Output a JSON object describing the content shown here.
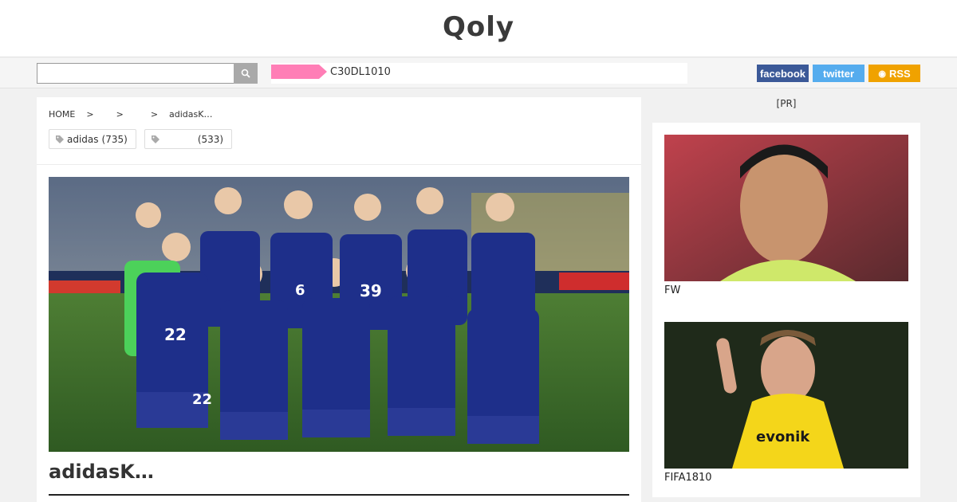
{
  "header": {
    "logo": "Qoly"
  },
  "navbar": {
    "search": {
      "placeholder": "",
      "value": ""
    },
    "ticker": {
      "badge_color": "#ff7eb6",
      "text": "C30DL1010"
    },
    "social": {
      "facebook": "facebook",
      "twitter": "twitter",
      "rss": "RSS"
    }
  },
  "breadcrumb": {
    "items": [
      "HOME",
      "",
      "",
      "adidasK…"
    ],
    "separator": ">"
  },
  "tags": [
    {
      "label": "adidas",
      "count": "(735)"
    },
    {
      "label": "",
      "count": "(533)"
    }
  ],
  "article": {
    "title": "adidasK…"
  },
  "sidebar": {
    "pr_label": "[PR]",
    "cards": [
      {
        "caption": "FW"
      },
      {
        "caption": "FIFA1810"
      }
    ]
  },
  "colors": {
    "facebook": "#3b5998",
    "twitter": "#55acee",
    "rss": "#f0a200",
    "pink": "#ff7eb6"
  }
}
